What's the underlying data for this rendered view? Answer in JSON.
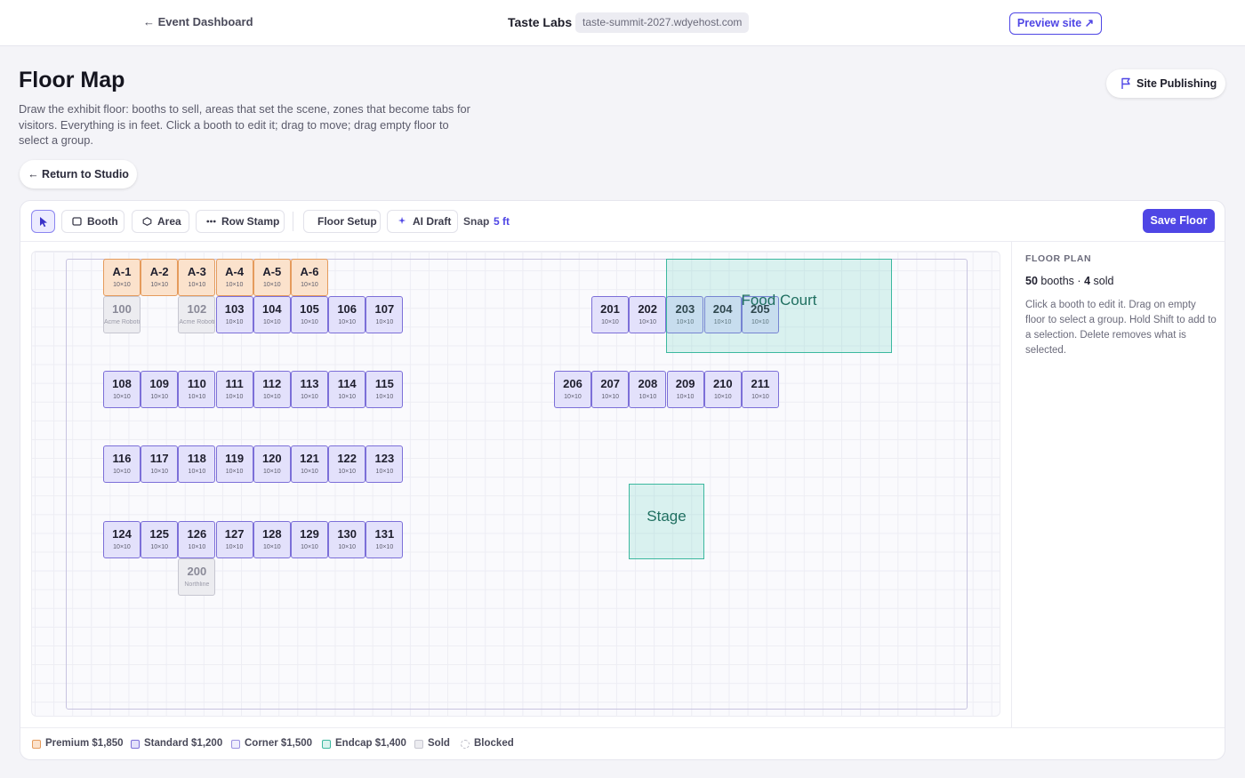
{
  "topbar": {
    "back_label": "← Event Dashboard",
    "brand": "Taste Labs",
    "domain": "taste-summit-2027.wdyehost.com",
    "preview_label": "Preview site ↗"
  },
  "header": {
    "title": "Floor Map",
    "description": "Draw the exhibit floor: booths to sell, areas that set the scene, zones that become tabs for visitors. Everything is in feet. Click a booth to edit it; drag to move; drag empty floor to select a group.",
    "return_label": "← Return to Studio",
    "publish_label": "Site Publishing"
  },
  "toolbar": {
    "booth": "Booth",
    "area": "Area",
    "row_stamp": "Row Stamp",
    "floor_setup": "Floor Setup",
    "ai_draft": "AI Draft",
    "snap_label": "Snap",
    "snap_value": "5 ft",
    "save_label": "Save Floor"
  },
  "booths": [
    {
      "label": "A-1",
      "size": "10×10",
      "tier": "premium"
    },
    {
      "label": "A-2",
      "size": "10×10",
      "tier": "premium"
    },
    {
      "label": "A-3",
      "size": "10×10",
      "tier": "premium"
    },
    {
      "label": "A-4",
      "size": "10×10",
      "tier": "premium"
    },
    {
      "label": "A-5",
      "size": "10×10",
      "tier": "premium"
    },
    {
      "label": "A-6",
      "size": "10×10",
      "tier": "premium"
    },
    {
      "label": "100",
      "size": "Acme Robotics",
      "tier": "sold"
    },
    {
      "label": "102",
      "size": "Acme Robotics",
      "tier": "sold"
    },
    {
      "label": "103",
      "size": "10×10",
      "tier": "standard"
    },
    {
      "label": "104",
      "size": "10×10",
      "tier": "standard"
    },
    {
      "label": "105",
      "size": "10×10",
      "tier": "standard"
    },
    {
      "label": "106",
      "size": "10×10",
      "tier": "standard"
    },
    {
      "label": "107",
      "size": "10×10",
      "tier": "standard"
    },
    {
      "label": "108",
      "size": "10×10",
      "tier": "standard"
    },
    {
      "label": "109",
      "size": "10×10",
      "tier": "standard"
    },
    {
      "label": "110",
      "size": "10×10",
      "tier": "standard"
    },
    {
      "label": "111",
      "size": "10×10",
      "tier": "standard"
    },
    {
      "label": "112",
      "size": "10×10",
      "tier": "standard"
    },
    {
      "label": "113",
      "size": "10×10",
      "tier": "standard"
    },
    {
      "label": "114",
      "size": "10×10",
      "tier": "standard"
    },
    {
      "label": "115",
      "size": "10×10",
      "tier": "standard"
    },
    {
      "label": "116",
      "size": "10×10",
      "tier": "standard"
    },
    {
      "label": "117",
      "size": "10×10",
      "tier": "standard"
    },
    {
      "label": "118",
      "size": "10×10",
      "tier": "standard"
    },
    {
      "label": "119",
      "size": "10×10",
      "tier": "standard"
    },
    {
      "label": "120",
      "size": "10×10",
      "tier": "standard"
    },
    {
      "label": "121",
      "size": "10×10",
      "tier": "standard"
    },
    {
      "label": "122",
      "size": "10×10",
      "tier": "standard"
    },
    {
      "label": "123",
      "size": "10×10",
      "tier": "standard"
    },
    {
      "label": "124",
      "size": "10×10",
      "tier": "standard"
    },
    {
      "label": "125",
      "size": "10×10",
      "tier": "standard"
    },
    {
      "label": "126",
      "size": "10×10",
      "tier": "standard"
    },
    {
      "label": "127",
      "size": "10×10",
      "tier": "standard"
    },
    {
      "label": "128",
      "size": "10×10",
      "tier": "standard"
    },
    {
      "label": "129",
      "size": "10×10",
      "tier": "standard"
    },
    {
      "label": "130",
      "size": "10×10",
      "tier": "standard"
    },
    {
      "label": "131",
      "size": "10×10",
      "tier": "standard"
    },
    {
      "label": "200",
      "size": "Northline",
      "tier": "sold"
    },
    {
      "label": "201",
      "size": "10×10",
      "tier": "standard"
    },
    {
      "label": "202",
      "size": "10×10",
      "tier": "standard"
    },
    {
      "label": "203",
      "size": "10×10",
      "tier": "standard"
    },
    {
      "label": "204",
      "size": "10×10",
      "tier": "standard"
    },
    {
      "label": "205",
      "size": "10×10",
      "tier": "standard"
    },
    {
      "label": "206",
      "size": "10×10",
      "tier": "standard"
    },
    {
      "label": "207",
      "size": "10×10",
      "tier": "standard"
    },
    {
      "label": "208",
      "size": "10×10",
      "tier": "standard"
    },
    {
      "label": "209",
      "size": "10×10",
      "tier": "standard"
    },
    {
      "label": "210",
      "size": "10×10",
      "tier": "standard"
    },
    {
      "label": "211",
      "size": "10×10",
      "tier": "standard"
    }
  ],
  "areas": [
    {
      "label": "Food Court"
    },
    {
      "label": "Stage"
    }
  ],
  "side": {
    "title": "FLOOR PLAN",
    "booth_count": "50",
    "booths_word": "booths",
    "sep": "·",
    "sold_count": "4",
    "sold_word": "sold",
    "help": "Click a booth to edit it. Drag on empty floor to select a group. Hold Shift to add to a selection. Delete removes what is selected."
  },
  "legend": [
    {
      "label": "Premium $1,850",
      "fill": "#fbe2cc",
      "stroke": "#e59b5c"
    },
    {
      "label": "Standard $1,200",
      "fill": "#e3e1fb",
      "stroke": "#7c6fd8"
    },
    {
      "label": "Corner $1,500",
      "fill": "#efeefd",
      "stroke": "#9a90e0"
    },
    {
      "label": "Endcap $1,400",
      "fill": "#d9f3ee",
      "stroke": "#3cb89f"
    },
    {
      "label": "Sold",
      "fill": "#ececf0",
      "stroke": "#c6c6d0"
    },
    {
      "label": "Blocked",
      "fill": "#ffffff",
      "stroke": "#b8b8c4"
    }
  ]
}
